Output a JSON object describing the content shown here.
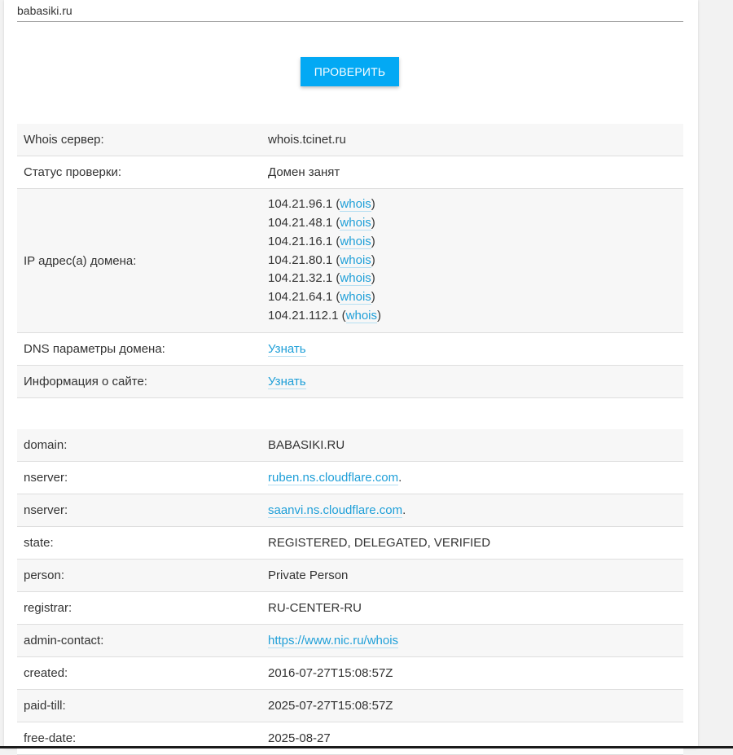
{
  "search": {
    "value": "babasiki.ru"
  },
  "check_button": "ПРОВЕРИТЬ",
  "summary": {
    "whois_server": {
      "label": "Whois сервер:",
      "value": "whois.tcinet.ru"
    },
    "status": {
      "label": "Статус проверки:",
      "value": "Домен занят"
    },
    "ips": {
      "label": "IP адрес(а) домена:",
      "link_text": "whois",
      "items": [
        "104.21.96.1",
        "104.21.48.1",
        "104.21.16.1",
        "104.21.80.1",
        "104.21.32.1",
        "104.21.64.1",
        "104.21.112.1"
      ]
    },
    "dns": {
      "label": "DNS параметры домена:",
      "link": "Узнать"
    },
    "site_info": {
      "label": "Информация о сайте:",
      "link": "Узнать"
    }
  },
  "whois": [
    {
      "key": "domain:",
      "value": "BABASIKI.RU"
    },
    {
      "key": "nserver:",
      "value": "ruben.ns.cloudflare.com",
      "link": true,
      "suffix": "."
    },
    {
      "key": "nserver:",
      "value": "saanvi.ns.cloudflare.com",
      "link": true,
      "suffix": "."
    },
    {
      "key": "state:",
      "value": "REGISTERED, DELEGATED, VERIFIED"
    },
    {
      "key": "person:",
      "value": "Private Person"
    },
    {
      "key": "registrar:",
      "value": "RU-CENTER-RU"
    },
    {
      "key": "admin-contact:",
      "value": "https://www.nic.ru/whois",
      "link": true
    },
    {
      "key": "created:",
      "value": "2016-07-27T15:08:57Z"
    },
    {
      "key": "paid-till:",
      "value": "2025-07-27T15:08:57Z"
    },
    {
      "key": "free-date:",
      "value": "2025-08-27"
    }
  ]
}
